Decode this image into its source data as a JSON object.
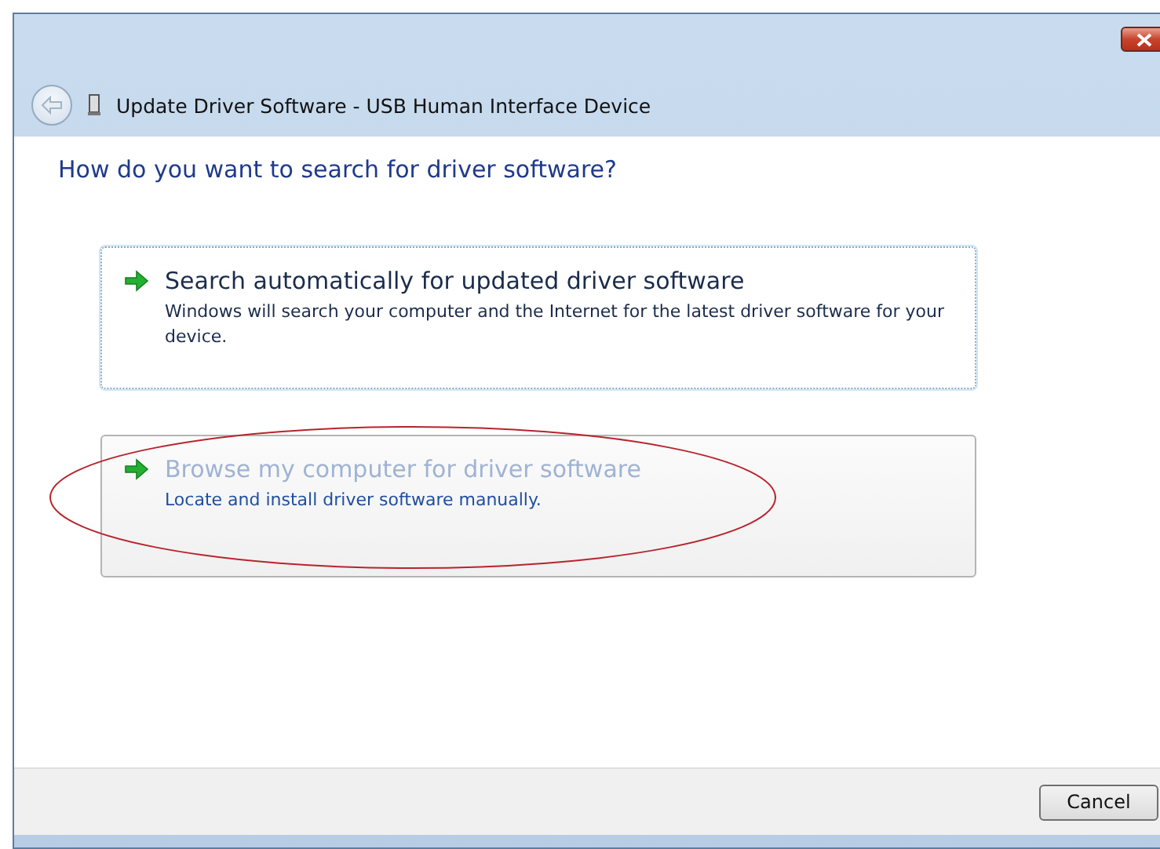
{
  "window": {
    "title": "Update Driver Software - USB Human Interface Device",
    "back_enabled": false
  },
  "heading": "How do you want to search for driver software?",
  "options": [
    {
      "title": "Search automatically for updated driver software",
      "description": "Windows will search your computer and the Internet for the latest driver software for your device.",
      "focused": true,
      "hovered": false
    },
    {
      "title": "Browse my computer for driver software",
      "description": "Locate and install driver software manually.",
      "focused": false,
      "hovered": true
    }
  ],
  "highlight_ellipse": true,
  "buttons": [
    "Cancel"
  ]
}
